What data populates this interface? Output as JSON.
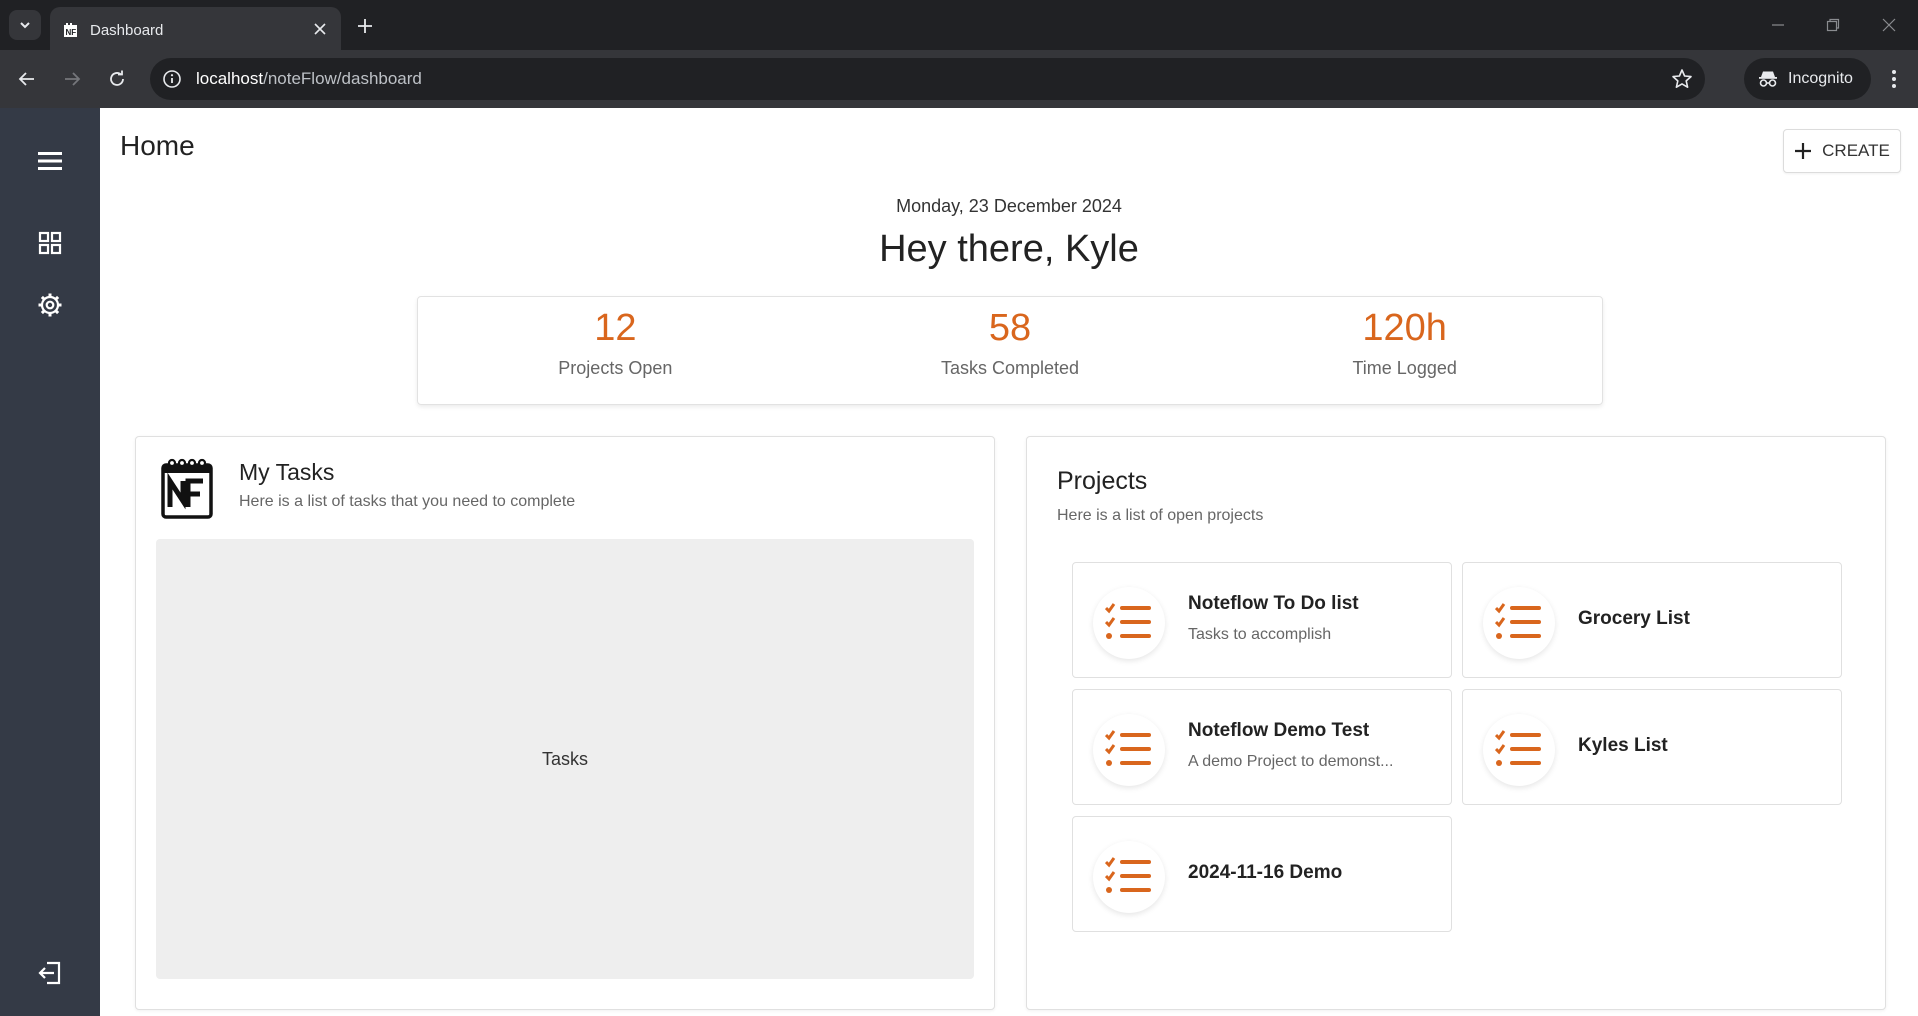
{
  "browser": {
    "tab_title": "Dashboard",
    "url_host": "localhost",
    "url_path": "/noteFlow/dashboard",
    "incognito_label": "Incognito"
  },
  "sidebar": {
    "items": [
      {
        "icon": "menu-icon"
      },
      {
        "icon": "dashboard-grid-icon"
      },
      {
        "icon": "settings-gear-icon"
      },
      {
        "icon": "logout-icon"
      }
    ]
  },
  "header": {
    "title": "Home",
    "create_label": "CREATE"
  },
  "welcome": {
    "date": "Monday, 23 December 2024",
    "greeting": "Hey there, Kyle"
  },
  "stats": [
    {
      "value": "12",
      "label": "Projects Open"
    },
    {
      "value": "58",
      "label": "Tasks Completed"
    },
    {
      "value": "120h",
      "label": "Time Logged"
    }
  ],
  "my_tasks": {
    "title": "My Tasks",
    "subtitle": "Here is a list of tasks that you need to complete",
    "placeholder": "Tasks"
  },
  "projects": {
    "title": "Projects",
    "subtitle": "Here is a list of open projects",
    "items": [
      {
        "name": "Noteflow To Do list",
        "description": "Tasks to accomplish"
      },
      {
        "name": "Grocery List",
        "description": ""
      },
      {
        "name": "Noteflow Demo Test",
        "description": "A demo Project to demonst..."
      },
      {
        "name": "Kyles List",
        "description": ""
      },
      {
        "name": "2024-11-16 Demo",
        "description": ""
      }
    ]
  },
  "colors": {
    "accent": "#d9661d",
    "sidebar": "#343a46"
  }
}
